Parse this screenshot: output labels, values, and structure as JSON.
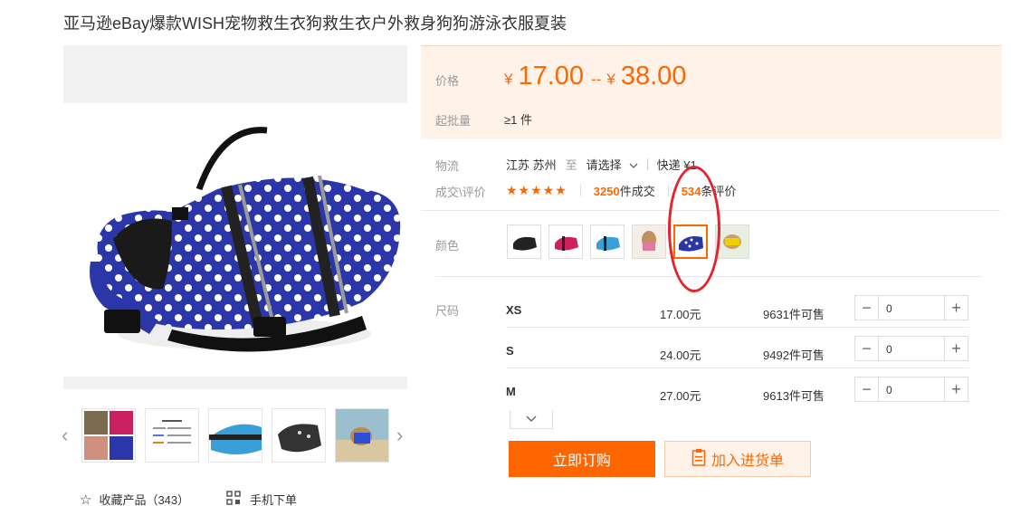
{
  "product": {
    "title": "亚马逊eBay爆款WISH宠物救生衣狗救生衣户外救身狗狗游泳衣服夏装"
  },
  "gallery": {
    "fav_label": "收藏产品（343）",
    "mobile_label": "手机下单",
    "prev_arrow": "‹",
    "next_arrow": "›"
  },
  "price": {
    "label": "价格",
    "currency": "¥",
    "min": "17.00",
    "separator": "--",
    "max": "38.00",
    "moq_label": "起批量",
    "moq_value": "≥1 件"
  },
  "logistics": {
    "label": "物流",
    "origin": "江苏 苏州",
    "to": "至",
    "destination": "请选择",
    "express": "快递 ¥1"
  },
  "deals": {
    "label": "成交\\评价",
    "stars": "★★★★★",
    "deal_count": "3250",
    "deal_suffix": "件成交",
    "review_count": "534",
    "review_suffix": "条评价"
  },
  "color": {
    "label": "颜色",
    "swatches": [
      "black",
      "red",
      "blue",
      "pink",
      "blue-dot",
      "yellow"
    ],
    "selected_index": 4
  },
  "size": {
    "label": "尺码",
    "rows": [
      {
        "code": "XS",
        "price": "17.00元",
        "stock": "9631件可售",
        "qty": "0"
      },
      {
        "code": "S",
        "price": "24.00元",
        "stock": "9492件可售",
        "qty": "0"
      },
      {
        "code": "M",
        "price": "27.00元",
        "stock": "9613件可售",
        "qty": "0"
      }
    ]
  },
  "actions": {
    "buy_now": "立即订购",
    "add_to_list": "加入进货单"
  },
  "colors": {
    "accent": "#ff6600",
    "price_bg": "#fff2e8",
    "annotation": "#e8222b"
  }
}
